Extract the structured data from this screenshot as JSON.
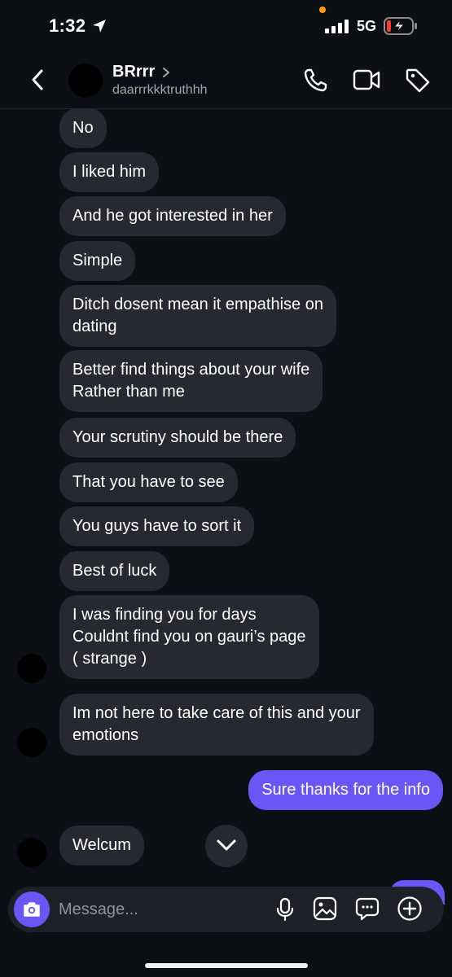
{
  "status_bar": {
    "time": "1:32",
    "network": "5G",
    "icons": [
      "location-arrow-icon",
      "signal-icon",
      "battery-charging-icon"
    ],
    "battery_color": "#ff3b30"
  },
  "header": {
    "name": "BRrrr",
    "username": "daarrrkkktruthhh",
    "icons": [
      "back-icon",
      "call-icon",
      "video-icon",
      "tag-icon"
    ]
  },
  "messages": [
    {
      "text": "No",
      "direction": "in"
    },
    {
      "text": "I liked him",
      "direction": "in"
    },
    {
      "text": "And he got interested in her",
      "direction": "in"
    },
    {
      "text": "Simple",
      "direction": "in"
    },
    {
      "text": "Ditch dosent mean it empathise on\ndating",
      "direction": "in"
    },
    {
      "text": "Better find things about your wife\nRather than me",
      "direction": "in"
    },
    {
      "text": "Your scrutiny should be there",
      "direction": "in"
    },
    {
      "text": "That you have to see",
      "direction": "in"
    },
    {
      "text": "You guys have to sort it",
      "direction": "in"
    },
    {
      "text": "Best of luck",
      "direction": "in"
    },
    {
      "text": "I was finding you for days\nCouldnt find you on gauri’s page\n( strange )",
      "direction": "in"
    },
    {
      "text": "Im not here to take care of this and your\nemotions",
      "direction": "in"
    },
    {
      "text": "Sure thanks for the info",
      "direction": "out"
    },
    {
      "text": "Welcum",
      "direction": "in"
    }
  ],
  "composer": {
    "placeholder": "Message...",
    "icons": [
      "camera-icon",
      "mic-icon",
      "gallery-icon",
      "sticker-icon",
      "plus-icon"
    ]
  },
  "colors": {
    "background": "#0c0f14",
    "incoming_bubble": "#262930",
    "outgoing_bubble": "#6a56f7",
    "accent": "#6a56f7"
  }
}
